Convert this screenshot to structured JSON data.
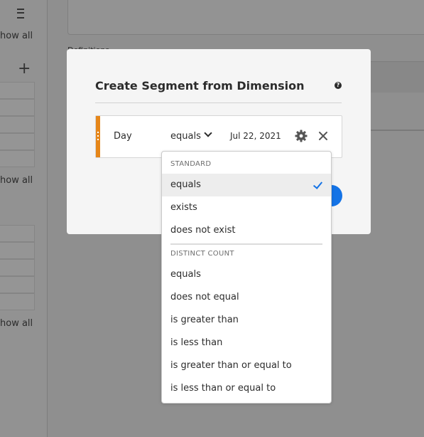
{
  "background": {
    "show_all_label": "how all",
    "definitions_label": "Definitions"
  },
  "modal": {
    "title": "Create Segment from Dimension",
    "help_icon": "question-circle-icon",
    "rule": {
      "dimension": "Day",
      "operator": "equals",
      "value": "Jul 22, 2021",
      "handle_color": "#e68619",
      "settings_icon": "gear-icon",
      "remove_icon": "close-icon"
    },
    "accent_color": "#1473e6"
  },
  "dropdown": {
    "standard_header": "STANDARD",
    "standard_items": [
      "equals",
      "exists",
      "does not exist"
    ],
    "selected": "equals",
    "distinct_header": "DISTINCT COUNT",
    "distinct_items": [
      "equals",
      "does not equal",
      "is greater than",
      "is less than",
      "is greater than or equal to",
      "is less than or equal to"
    ]
  }
}
